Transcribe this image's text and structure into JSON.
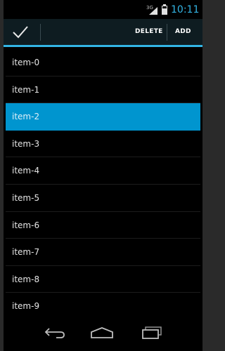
{
  "status_bar": {
    "network_label": "3G",
    "time": "10:11"
  },
  "action_bar": {
    "done_icon": "checkmark-icon",
    "delete_label": "DELETE",
    "add_label": "ADD"
  },
  "list": {
    "items": [
      "item-0",
      "item-1",
      "item-2",
      "item-3",
      "item-4",
      "item-5",
      "item-6",
      "item-7",
      "item-8",
      "item-9"
    ],
    "selected": "item-2"
  },
  "nav_bar": {
    "icons": [
      "back-icon",
      "home-icon",
      "recent-apps-icon"
    ]
  },
  "colors": {
    "accent": "#33b5e5",
    "selected_bg": "#0095cf",
    "background": "#000000"
  }
}
